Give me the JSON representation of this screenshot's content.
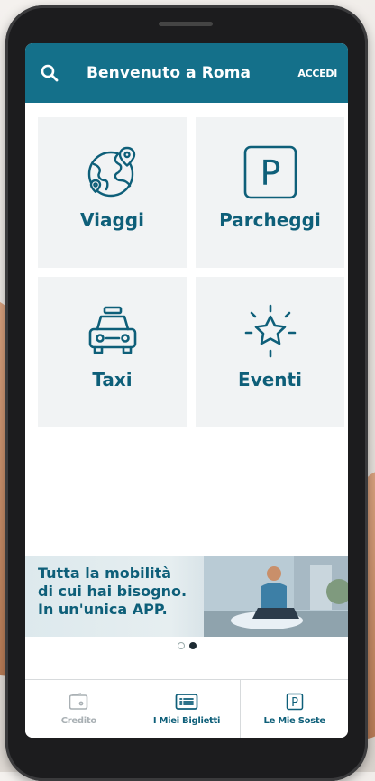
{
  "colors": {
    "brand": "#14708a",
    "brand_text": "#0e5f79",
    "tile_bg": "#f1f3f4"
  },
  "header": {
    "title": "Benvenuto a Roma",
    "login_label": "ACCEDI",
    "search_icon": "search-icon"
  },
  "tiles": [
    {
      "label": "Viaggi",
      "icon": "globe-pin-icon"
    },
    {
      "label": "Parcheggi",
      "icon": "parking-icon"
    },
    {
      "label": "Taxi",
      "icon": "taxi-icon"
    },
    {
      "label": "Eventi",
      "icon": "star-burst-icon"
    }
  ],
  "banner": {
    "lines": [
      "Tutta la mobilità",
      "di cui hai bisogno.",
      "In un'unica APP."
    ]
  },
  "carousel": {
    "page_count": 2,
    "active_index": 1
  },
  "bottom_nav": [
    {
      "label": "Credito",
      "icon": "wallet-icon",
      "enabled": false
    },
    {
      "label": "I Miei Biglietti",
      "icon": "ticket-icon",
      "enabled": true
    },
    {
      "label": "Le Mie Soste",
      "icon": "parking-icon",
      "enabled": true
    }
  ]
}
